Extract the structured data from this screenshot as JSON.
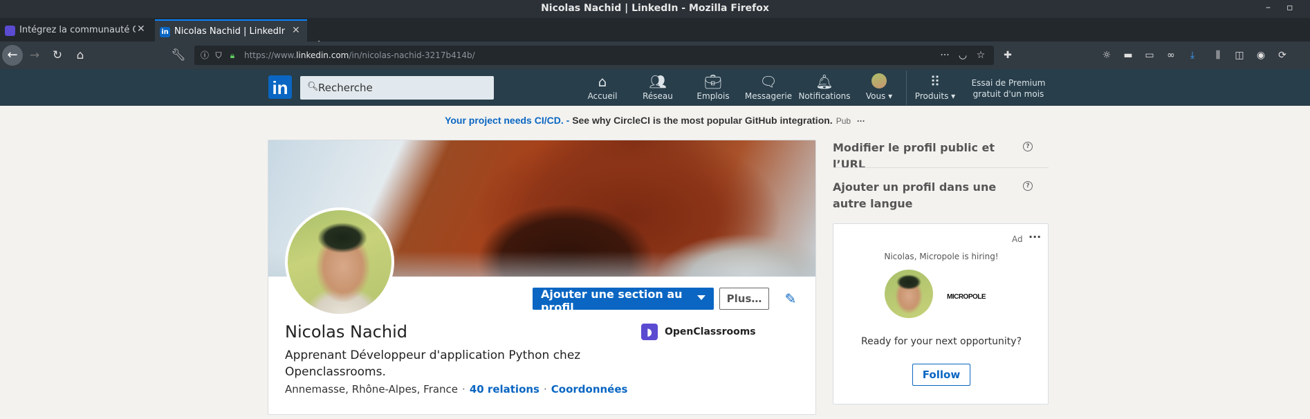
{
  "window": {
    "title": "Nicolas Nachid | LinkedIn - Mozilla Firefox"
  },
  "tabs": [
    {
      "label": "Intégrez la communauté Ope",
      "active": false
    },
    {
      "label": "Nicolas Nachid | LinkedIn",
      "active": true
    }
  ],
  "address_bar": {
    "url_prefix": "https://www.",
    "url_domain": "linkedin.com",
    "url_path": "/in/nicolas-nachid-3217b414b/"
  },
  "linkedin": {
    "logo_text": "in",
    "search": {
      "placeholder": "Recherche"
    },
    "nav": [
      {
        "label": "Accueil",
        "icon": "home-icon"
      },
      {
        "label": "Réseau",
        "icon": "network-icon"
      },
      {
        "label": "Emplois",
        "icon": "jobs-icon"
      },
      {
        "label": "Messagerie",
        "icon": "messaging-icon"
      },
      {
        "label": "Notifications",
        "icon": "notifications-icon"
      },
      {
        "label": "Vous",
        "icon": "avatar"
      },
      {
        "label": "Produits",
        "icon": "grid-icon"
      }
    ],
    "premium_line1": "Essai de Premium",
    "premium_line2": "gratuit d'un mois"
  },
  "ad_banner": {
    "highlight": "Your project needs CI/CD.",
    "dash": " - ",
    "text": "See why CircleCI is the most popular GitHub integration.",
    "pub": "Pub",
    "more": "···"
  },
  "profile": {
    "add_section_label": "Ajouter une section au profil",
    "more_label": "Plus…",
    "name": "Nicolas Nachid",
    "headline": "Apprenant Développeur d'application Python chez Openclassrooms.",
    "location": "Annemasse, Rhône-Alpes, France",
    "relations": "40 relations",
    "contact": "Coordonnées",
    "sep": "·",
    "company": "OpenClassrooms"
  },
  "right_rail": {
    "edit_public_profile": "Modifier le profil public et l’URL",
    "add_language_profile": "Ajouter un profil dans une autre langue",
    "help": "?",
    "ad": {
      "label": "Ad",
      "more": "···",
      "hiring": "Nicolas, Micropole is hiring!",
      "company_logo_text": "MICROPOLE",
      "opportunity": "Ready for your next opportunity?",
      "follow_label": "Follow"
    }
  },
  "colors": {
    "linkedin_blue": "#0a66c2",
    "header_bg": "#283e4a",
    "firefox_dark": "#323a42"
  }
}
